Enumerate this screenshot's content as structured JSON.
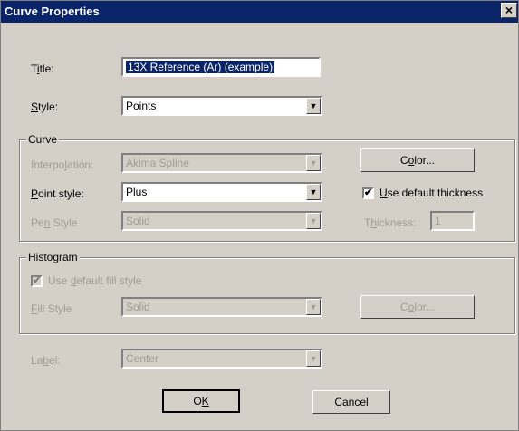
{
  "window": {
    "title": "Curve Properties",
    "close_glyph": "×"
  },
  "title_field": {
    "label_accel": "i",
    "label_pre": "T",
    "label_post": "tle:",
    "value": "13X Reference (Ar) (example)"
  },
  "style_field": {
    "label_accel": "S",
    "label_post": "tyle:",
    "value": "Points"
  },
  "curve": {
    "group_label": "Curve",
    "interpolation": {
      "label_pre": "Interpo",
      "label_accel": "l",
      "label_post": "ation:",
      "value": "Akima Spline"
    },
    "point_style": {
      "label_accel": "P",
      "label_post": "oint style:",
      "value": "Plus"
    },
    "pen_style": {
      "label_pre": "Pe",
      "label_accel": "n",
      "label_post": " Style",
      "value": "Solid"
    },
    "color_button": {
      "label_pre": "C",
      "label_accel": "o",
      "label_post": "lor..."
    },
    "use_default_thickness": {
      "label_accel": "U",
      "label_post": "se default thickness",
      "checked": true
    },
    "thickness": {
      "label_pre": "T",
      "label_accel": "h",
      "label_post": "ickness:",
      "value": "1"
    }
  },
  "histogram": {
    "group_label": "Histogram",
    "use_default_fill": {
      "label_pre": "Use ",
      "label_accel": "d",
      "label_post": "efault fill style",
      "checked": true
    },
    "fill_style": {
      "label_accel": "F",
      "label_post": "ill Style",
      "value": "Solid"
    },
    "color_button": {
      "label_pre": "C",
      "label_accel": "o",
      "label_post": "lor..."
    }
  },
  "label_field": {
    "label_pre": "La",
    "label_accel": "b",
    "label_post": "el:",
    "value": "Center"
  },
  "buttons": {
    "ok": {
      "label_pre": "O",
      "label_accel": "K",
      "label_post": ""
    },
    "cancel": {
      "label_accel": "C",
      "label_post": "ancel"
    }
  },
  "icons": {
    "dropdown": "▼",
    "check": "✔"
  }
}
